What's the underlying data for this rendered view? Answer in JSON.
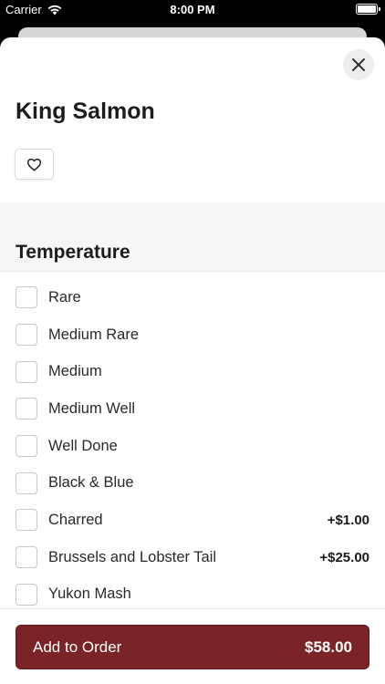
{
  "status_bar": {
    "carrier": "Carrier",
    "time": "8:00 PM",
    "wifi_icon": "wifi-icon",
    "battery_icon": "battery-icon"
  },
  "sheet": {
    "close_icon": "close-icon",
    "title": "King Salmon",
    "favorite_icon": "heart-icon"
  },
  "section": {
    "title": "Temperature"
  },
  "options": [
    {
      "label": "Rare",
      "price": ""
    },
    {
      "label": "Medium Rare",
      "price": ""
    },
    {
      "label": "Medium",
      "price": ""
    },
    {
      "label": "Medium Well",
      "price": ""
    },
    {
      "label": "Well Done",
      "price": ""
    },
    {
      "label": "Black & Blue",
      "price": ""
    },
    {
      "label": "Charred",
      "price": "+$1.00"
    },
    {
      "label": "Brussels and Lobster Tail",
      "price": "+$25.00"
    },
    {
      "label": "Yukon Mash",
      "price": ""
    }
  ],
  "footer": {
    "add_label": "Add to Order",
    "total": "$58.00"
  },
  "colors": {
    "accent": "#7b2428",
    "band": "#f6f6f6"
  }
}
